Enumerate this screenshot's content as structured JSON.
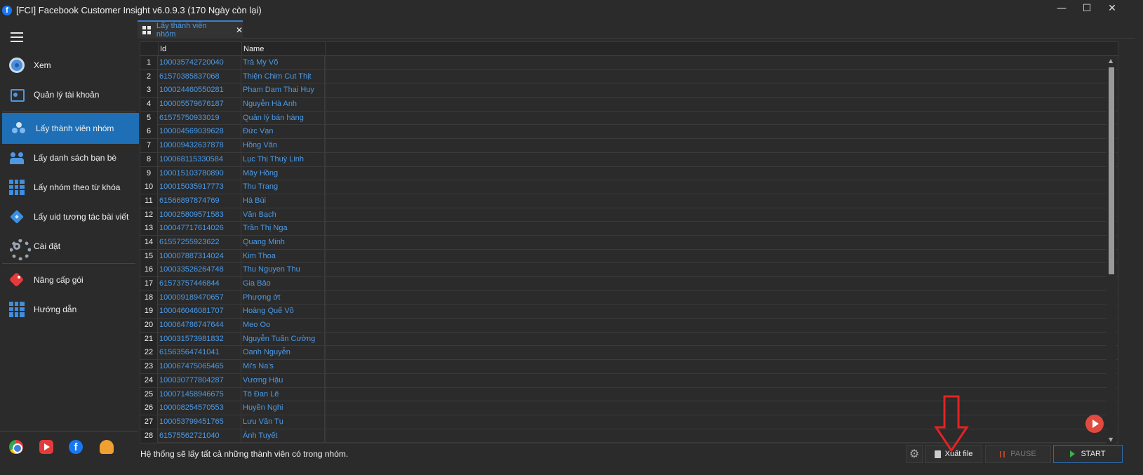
{
  "window": {
    "title": "[FCI] Facebook Customer Insight v6.0.9.3 (170 Ngày còn lại)",
    "controls": {
      "minimize": "—",
      "maximize": "☐",
      "close": "✕"
    },
    "app_icon": "f"
  },
  "sidebar": {
    "menu_icon": "hamburger-icon",
    "items": [
      {
        "label": "Xem",
        "icon": "browser-icon"
      },
      {
        "label": "Quản lý tài khoản",
        "icon": "account-icon"
      },
      {
        "label": "Lấy thành viên nhóm",
        "icon": "group-members-icon",
        "active": true
      },
      {
        "label": "Lấy danh sách bạn bè",
        "icon": "friends-icon"
      },
      {
        "label": "Lấy nhóm theo từ khóa",
        "icon": "grid-icon"
      },
      {
        "label": "Lấy uid tương tác bài viết",
        "icon": "diamond-icon"
      },
      {
        "label": "Cài đặt",
        "icon": "gear-icon"
      },
      {
        "label": "Nâng cấp gói",
        "icon": "tag-icon"
      },
      {
        "label": "Hướng dẫn",
        "icon": "grid-icon"
      }
    ],
    "bottom": {
      "fb_letter": "f"
    }
  },
  "tab": {
    "label": "Lấy thành viên nhóm",
    "close": "✕"
  },
  "table": {
    "columns": {
      "id": "Id",
      "name": "Name"
    },
    "rows": [
      {
        "n": "1",
        "id": "100035742720040",
        "name": "Trà My Võ"
      },
      {
        "n": "2",
        "id": "61570385837068",
        "name": "Thiện Chim Cut Thịt"
      },
      {
        "n": "3",
        "id": "100024460550281",
        "name": "Pham Dam Thai Huy"
      },
      {
        "n": "4",
        "id": "100005579676187",
        "name": "Nguyễn Hà Anh"
      },
      {
        "n": "5",
        "id": "61575750933019",
        "name": "Quản lý bán hàng"
      },
      {
        "n": "6",
        "id": "100004569039628",
        "name": "Đức Vạn"
      },
      {
        "n": "7",
        "id": "100009432637878",
        "name": "Hồng Vân"
      },
      {
        "n": "8",
        "id": "100068115330584",
        "name": "Lục Thị Thuỳ Linh"
      },
      {
        "n": "9",
        "id": "100015103780890",
        "name": "Mây Hồng"
      },
      {
        "n": "10",
        "id": "100015035917773",
        "name": "Thu Trang"
      },
      {
        "n": "11",
        "id": "61566897874769",
        "name": "Hà Bùi"
      },
      {
        "n": "12",
        "id": "100025809571583",
        "name": "Văn Bạch"
      },
      {
        "n": "13",
        "id": "100047717614026",
        "name": "Trần Thị Nga"
      },
      {
        "n": "14",
        "id": "61557255923622",
        "name": "Quang Minh"
      },
      {
        "n": "15",
        "id": "100007887314024",
        "name": "Kim Thoa"
      },
      {
        "n": "16",
        "id": "100033526264748",
        "name": "Thu Nguyen Thu"
      },
      {
        "n": "17",
        "id": "61573757446844",
        "name": "Gia Bảo"
      },
      {
        "n": "18",
        "id": "100009189470657",
        "name": "Phượng ớt"
      },
      {
        "n": "19",
        "id": "100046046081707",
        "name": "Hoàng Quế Võ"
      },
      {
        "n": "20",
        "id": "100064786747644",
        "name": "Meo Oo"
      },
      {
        "n": "21",
        "id": "100031573981832",
        "name": "Nguyễn Tuấn Cường"
      },
      {
        "n": "22",
        "id": "61563564741041",
        "name": "Oanh Nguyễn"
      },
      {
        "n": "23",
        "id": "100067475065465",
        "name": "Mi's Na's"
      },
      {
        "n": "24",
        "id": "100030777804287",
        "name": "Vương Hậu"
      },
      {
        "n": "25",
        "id": "100071458946675",
        "name": "Tô Đan Lê"
      },
      {
        "n": "26",
        "id": "100008254570553",
        "name": "Huyền Nghi"
      },
      {
        "n": "27",
        "id": "100053799451765",
        "name": "Lưu Văn Tụ"
      },
      {
        "n": "28",
        "id": "61575562721040",
        "name": "Ánh Tuyết"
      }
    ]
  },
  "status": {
    "message": "Hệ thống sẽ lấy tất cả những thành viên có trong nhóm.",
    "export_label": "Xuất file",
    "pause_label": "PAUSE",
    "start_label": "START"
  },
  "colors": {
    "accent": "#1e6fb5",
    "link": "#4a9ae8",
    "background": "#2b2b2b",
    "annotation": "#e52222"
  }
}
